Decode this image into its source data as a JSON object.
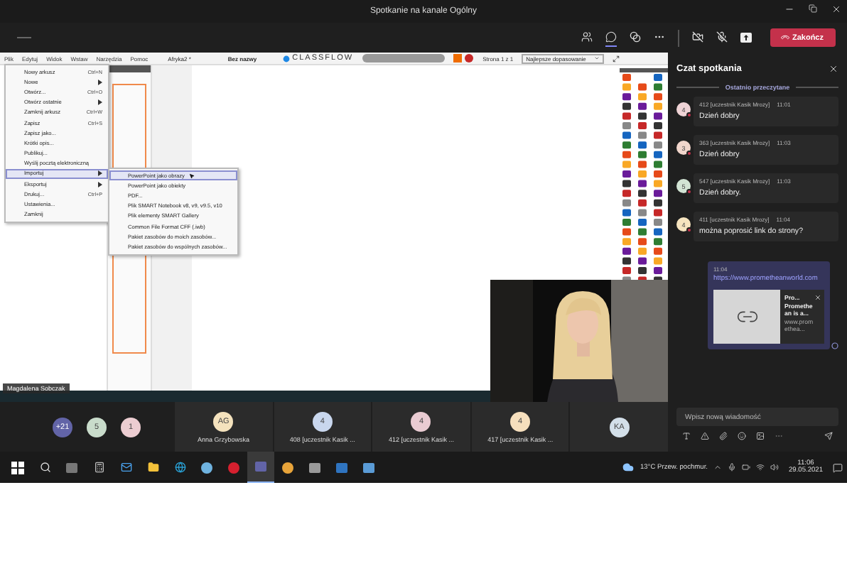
{
  "window": {
    "title": "Spotkanie na kanale Ogólny"
  },
  "toolbar": {
    "chat_selected": true,
    "end_button": "Zakończ"
  },
  "shared_screen": {
    "menubar": [
      "Plik",
      "Edytuj",
      "Widok",
      "Wstaw",
      "Narzędzia",
      "Pomoc"
    ],
    "tabs": [
      {
        "label": "Afryka2 *",
        "selected": false
      },
      {
        "label": "Bez nazwy",
        "selected": true
      }
    ],
    "brand": "CLASSFLOW",
    "page": "Strona 1 z 1",
    "zoom": "Najlepsze dopasowanie",
    "menu": [
      {
        "label": "Nowy arkusz",
        "shortcut": "Ctrl+N",
        "submenu": false,
        "selected": false
      },
      {
        "label": "Nowe",
        "submenu": true,
        "selected": false
      },
      {
        "label": "Otwórz...",
        "shortcut": "Ctrl+O",
        "submenu": false,
        "selected": false
      },
      {
        "label": "Otwórz ostatnie",
        "submenu": true,
        "selected": false
      },
      {
        "label": "Zamknij arkusz",
        "shortcut": "Ctrl+W",
        "submenu": false,
        "selected": false
      },
      {
        "label": "Zapisz",
        "shortcut": "Ctrl+S",
        "submenu": false,
        "selected": false
      },
      {
        "label": "Zapisz jako...",
        "submenu": false,
        "selected": false
      },
      {
        "label": "Krótki opis...",
        "submenu": false,
        "selected": false
      },
      {
        "label": "Publikuj...",
        "submenu": false,
        "selected": false
      },
      {
        "label": "Wyślij pocztą elektroniczną",
        "submenu": false,
        "selected": false
      },
      {
        "label": "Importuj",
        "submenu": true,
        "selected": true
      },
      {
        "label": "Eksportuj",
        "submenu": true,
        "selected": false
      },
      {
        "label": "Drukuj...",
        "shortcut": "Ctrl+P",
        "submenu": false,
        "selected": false
      },
      {
        "label": "Ustawienia...",
        "submenu": false,
        "selected": false
      },
      {
        "label": "Zamknij",
        "submenu": false,
        "selected": false
      }
    ],
    "submenu": [
      {
        "label": "PowerPoint jako obrazy",
        "selected": true
      },
      {
        "label": "PowerPoint jako obiekty",
        "selected": false
      },
      {
        "label": "PDF...",
        "selected": false
      },
      {
        "label": "Plik SMART Notebook v8, v9, v9.5, v10",
        "selected": false
      },
      {
        "label": "Plik elementy SMART Gallery",
        "selected": false
      },
      {
        "label": "Common File Format CFF (.iwb)",
        "selected": false
      },
      {
        "label": "Pakiet zasobów do moich zasobów...",
        "selected": false
      },
      {
        "label": "Pakiet zasobów do wspólnych zasobów...",
        "selected": false
      }
    ],
    "presenter": "Magdalena Sobczak"
  },
  "participants": {
    "overflow": [
      {
        "label": "+21",
        "color": "#6264a7"
      },
      {
        "label": "5",
        "color": "#c9dccb"
      },
      {
        "label": "1",
        "color": "#eccdd1"
      }
    ],
    "tiles": [
      {
        "initials": "AG",
        "name": "Anna Grzybowska",
        "color": "#f4e2bd"
      },
      {
        "initials": "4",
        "name": "408 [uczestnik Kasik ...",
        "color": "#c9d7ee"
      },
      {
        "initials": "4",
        "name": "412 [uczestnik Kasik ...",
        "color": "#e9cbd2"
      },
      {
        "initials": "4",
        "name": "417 [uczestnik Kasik ...",
        "color": "#f6dfbd"
      },
      {
        "initials": "KA",
        "color": "#d3dfe9"
      }
    ]
  },
  "chat": {
    "title": "Czat spotkania",
    "divider": "Ostatnio przeczytane",
    "messages": [
      {
        "initial": "4",
        "color": "#efd3d6",
        "sender": "412 [uczestnik Kasik Mrozy]",
        "time": "11:01",
        "text": "Dzień dobry"
      },
      {
        "initial": "3",
        "color": "#f1d6cc",
        "sender": "363 [uczestnik Kasik Mrozy]",
        "time": "11:03",
        "text": "Dzień dobry"
      },
      {
        "initial": "5",
        "color": "#d2e4d4",
        "sender": "547 [uczestnik Kasik Mrozy]",
        "time": "11:03",
        "text": "Dzień dobry."
      },
      {
        "initial": "4",
        "color": "#f6e4bf",
        "sender": "411 [uczestnik Kasik Mrozy]",
        "time": "11:04",
        "text": "można poprosić link do strony?"
      }
    ],
    "own_message": {
      "time": "11:04",
      "link": "https://www.prometheanworld.com",
      "preview": {
        "title": "Pro...",
        "description": "Promethean is a...",
        "site": "www.promethea..."
      }
    },
    "composer": {
      "placeholder": "Wpisz nową wiadomość"
    }
  },
  "taskbar": {
    "weather": "13°C Przew. pochmur.",
    "time": "11:06",
    "date": "29.05.2021"
  }
}
